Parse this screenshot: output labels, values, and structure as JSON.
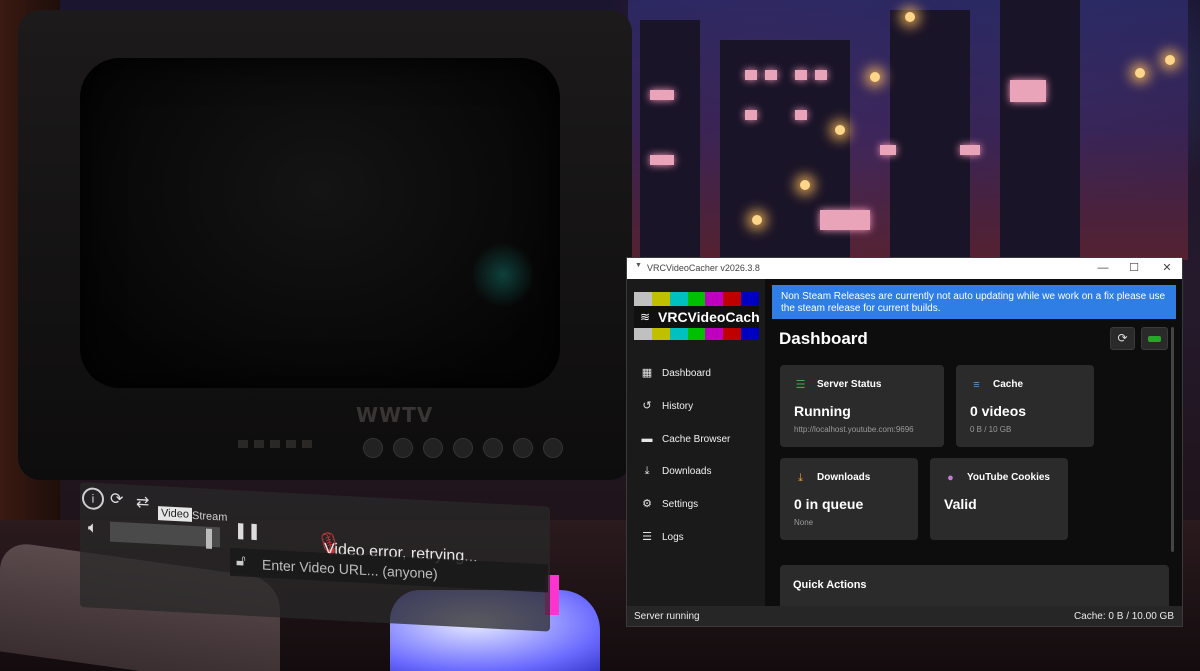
{
  "scene": {
    "tv_brand": "WWTV",
    "player": {
      "mode_video": "Video",
      "mode_stream": "Stream",
      "status_text": "Video error, retrying...",
      "url_placeholder": "Enter Video URL... (anyone)"
    }
  },
  "window": {
    "title": "VRCVideoCacher v2026.3.8",
    "controls": {
      "minimize": "—",
      "maximize": "☐",
      "close": "✕"
    }
  },
  "sidebar": {
    "logo_text": "VRCVideoCacher",
    "logo_bar_colors": [
      "#c0c0c0",
      "#c0c000",
      "#00c0c0",
      "#00c000",
      "#c000c0",
      "#c00000",
      "#0000c0"
    ],
    "items": [
      {
        "label": "Dashboard",
        "icon": "grid-icon",
        "glyph": "▦"
      },
      {
        "label": "History",
        "icon": "history-icon",
        "glyph": "↺"
      },
      {
        "label": "Cache Browser",
        "icon": "folder-icon",
        "glyph": "▬"
      },
      {
        "label": "Downloads",
        "icon": "download-icon",
        "glyph": "⤓"
      },
      {
        "label": "Settings",
        "icon": "gear-icon",
        "glyph": "⚙"
      },
      {
        "label": "Logs",
        "icon": "document-icon",
        "glyph": "☰"
      }
    ]
  },
  "main": {
    "banner": "Non Steam Releases are currently not auto updating while we work on a fix please use the steam release for current builds.",
    "title": "Dashboard",
    "cards": {
      "server": {
        "title": "Server Status",
        "value": "Running",
        "sub": "http://localhost.youtube.com:9696",
        "icon_color": "#3fae4a"
      },
      "cache": {
        "title": "Cache",
        "value": "0 videos",
        "sub": "0 B  /  10 GB",
        "icon_color": "#4a9ce6"
      },
      "downloads": {
        "title": "Downloads",
        "value": "0 in queue",
        "sub": "None",
        "icon_color": "#e6a23a"
      },
      "cookies": {
        "title": "YouTube Cookies",
        "value": "Valid",
        "sub": "",
        "icon_color": "#c77ad8"
      }
    },
    "quick_actions": "Quick Actions"
  },
  "status": {
    "left": "Server running",
    "right": "Cache: 0 B / 10.00 GB"
  }
}
